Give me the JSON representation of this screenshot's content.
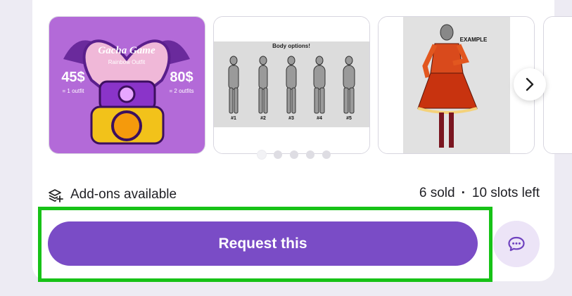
{
  "gallery": {
    "images": [
      {
        "alt": "Gacha Game pricing artwork",
        "texts": {
          "title": "Gacha Game",
          "subtitle": "Rainbow Outfit",
          "left_price": "45$",
          "left_note": "= 1 outfit",
          "right_price": "80$",
          "right_note": "= 2 outfits"
        }
      },
      {
        "alt": "Body options reference sheet",
        "texts": {
          "title": "Body options!",
          "labels": [
            "#1",
            "#2",
            "#3",
            "#4",
            "#5"
          ]
        }
      },
      {
        "alt": "Example outfit drawing",
        "texts": {
          "label": "EXAMPLE"
        }
      },
      {
        "alt": "Next image (partially visible)"
      }
    ],
    "dots_count": 5,
    "active_dot": 0,
    "next_icon": "chevron-right-icon"
  },
  "details": {
    "addons_label": "Add-ons available",
    "addons_icon": "layers-plus-icon",
    "sold_label": "6 sold",
    "separator": "·",
    "slots_label": "10 slots left"
  },
  "actions": {
    "request_label": "Request this",
    "chat_icon": "chat-bubble-icon"
  },
  "colors": {
    "primary": "#7a4cc6",
    "chat_bg": "#ece4f7",
    "highlight": "#17c217",
    "page_bg": "#edebf3"
  }
}
